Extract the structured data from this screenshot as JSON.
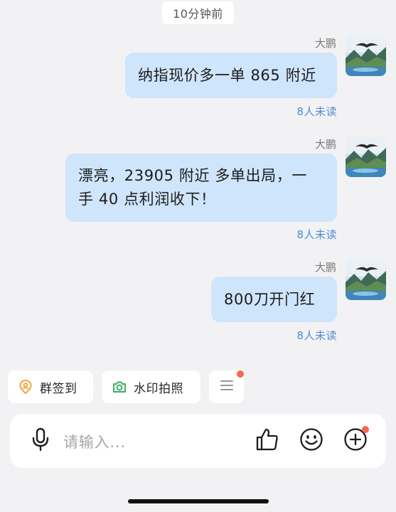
{
  "timestamp": "10分钟前",
  "messages": [
    {
      "sender": "大鹏",
      "lines": [
        "纳指现价多一单 865 附近"
      ],
      "status": "8人未读"
    },
    {
      "sender": "大鹏",
      "lines": [
        "漂亮，23905 附近 多单出局，一",
        "手 40 点利润收下！"
      ],
      "status": "8人未读"
    },
    {
      "sender": "大鹏",
      "lines": [
        "800刀开门红"
      ],
      "status": "8人未读"
    }
  ],
  "quick_actions": [
    {
      "label": "群签到",
      "icon": "location-pin-icon",
      "color": "#f0a33a"
    },
    {
      "label": "水印拍照",
      "icon": "camera-icon",
      "color": "#3aab5e"
    },
    {
      "label": "",
      "icon": "menu-icon",
      "color": "#8a8a8a"
    }
  ],
  "input": {
    "placeholder": "请输入..."
  },
  "colors": {
    "bubble": "#cfe5fb",
    "unread": "#4f8dd1",
    "badge": "#f26a4a"
  }
}
